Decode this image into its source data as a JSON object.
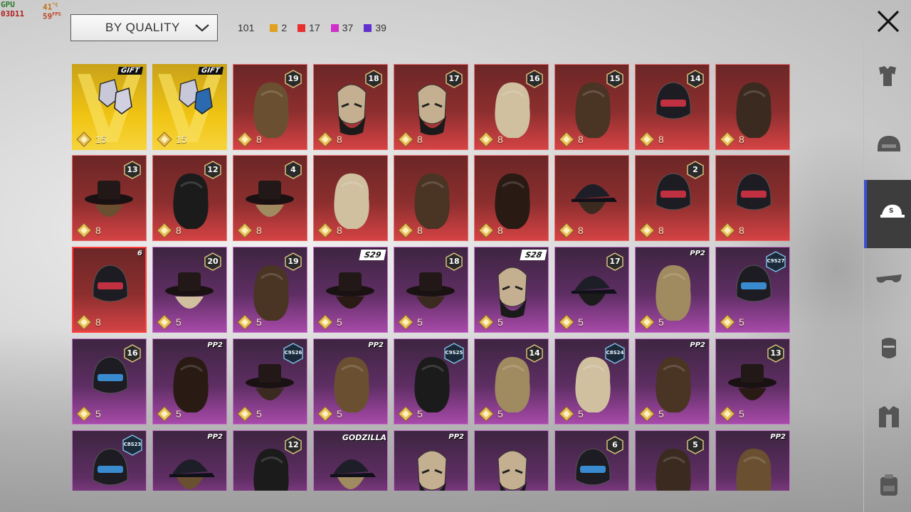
{
  "hud": {
    "gpu_label": "GPU",
    "gpu_value": "03D11",
    "temp": "41",
    "temp_unit": "°C",
    "fps": "59",
    "fps_unit": "FPS"
  },
  "sort": {
    "label": "BY QUALITY"
  },
  "counts": {
    "total": "101",
    "items": [
      {
        "value": "2",
        "color": "#e0a020"
      },
      {
        "value": "17",
        "color": "#e83030"
      },
      {
        "value": "37",
        "color": "#d030c8"
      },
      {
        "value": "39",
        "color": "#6030d0"
      }
    ]
  },
  "tiles": [
    {
      "quality": "legend",
      "price": "15",
      "tag": "GIFT",
      "icon": "legendary-bundle-icon"
    },
    {
      "quality": "legend",
      "price": "15",
      "tag": "GIFT",
      "icon": "legendary-bundle-icon"
    },
    {
      "quality": "red",
      "price": "8",
      "badge": "19",
      "icon": "hair-icon"
    },
    {
      "quality": "red",
      "price": "8",
      "badge": "18",
      "icon": "mask-icon"
    },
    {
      "quality": "red",
      "price": "8",
      "badge": "17",
      "icon": "mask-icon"
    },
    {
      "quality": "red",
      "price": "8",
      "badge": "16",
      "icon": "hair-icon"
    },
    {
      "quality": "red",
      "price": "8",
      "badge": "15",
      "icon": "hair-icon"
    },
    {
      "quality": "red",
      "price": "8",
      "badge": "14",
      "icon": "helmet-icon"
    },
    {
      "quality": "red",
      "price": "8",
      "icon": "hair-icon"
    },
    {
      "quality": "red",
      "price": "8",
      "badge": "13",
      "icon": "hat-icon"
    },
    {
      "quality": "red",
      "price": "8",
      "badge": "12",
      "icon": "hair-icon"
    },
    {
      "quality": "red",
      "price": "8",
      "badge": "4",
      "icon": "hat-icon"
    },
    {
      "quality": "red",
      "price": "8",
      "icon": "hair-icon"
    },
    {
      "quality": "red",
      "price": "8",
      "icon": "hair-icon"
    },
    {
      "quality": "red",
      "price": "8",
      "icon": "hair-icon"
    },
    {
      "quality": "red",
      "price": "8",
      "icon": "cap-icon"
    },
    {
      "quality": "red",
      "price": "8",
      "badge": "2",
      "icon": "helmet-icon"
    },
    {
      "quality": "red",
      "price": "8",
      "icon": "helmet-icon"
    },
    {
      "quality": "red",
      "price": "8",
      "tag": "6",
      "icon": "helmet-icon",
      "highlight": true
    },
    {
      "quality": "purple",
      "price": "5",
      "badge": "20",
      "icon": "hat-icon"
    },
    {
      "quality": "purple",
      "price": "5",
      "badge": "19",
      "icon": "hair-icon"
    },
    {
      "quality": "purple",
      "price": "5",
      "ribbon": "S29",
      "icon": "hat-icon"
    },
    {
      "quality": "purple",
      "price": "5",
      "badge": "18",
      "icon": "hat-icon"
    },
    {
      "quality": "purple",
      "price": "5",
      "ribbon": "S28",
      "icon": "mask-icon"
    },
    {
      "quality": "purple",
      "price": "5",
      "badge": "17",
      "icon": "cap-icon"
    },
    {
      "quality": "purple",
      "price": "5",
      "tag": "PP2",
      "icon": "hair-icon"
    },
    {
      "quality": "purple",
      "price": "5",
      "season": "C9S27",
      "icon": "helmet-icon"
    },
    {
      "quality": "purple",
      "price": "5",
      "badge": "16",
      "icon": "helmet-icon"
    },
    {
      "quality": "purple",
      "price": "5",
      "tag": "PP2",
      "icon": "hair-icon"
    },
    {
      "quality": "purple",
      "price": "5",
      "season": "C9S26",
      "icon": "hat-icon"
    },
    {
      "quality": "purple",
      "price": "5",
      "tag": "PP2",
      "icon": "hair-icon"
    },
    {
      "quality": "purple",
      "price": "5",
      "season": "C9S25",
      "icon": "hair-icon"
    },
    {
      "quality": "purple",
      "price": "5",
      "badge": "14",
      "icon": "hair-icon"
    },
    {
      "quality": "purple",
      "price": "5",
      "season": "C8S24",
      "icon": "hair-icon"
    },
    {
      "quality": "purple",
      "price": "5",
      "tag": "PP2",
      "icon": "hair-icon"
    },
    {
      "quality": "purple",
      "price": "5",
      "badge": "13",
      "icon": "hat-icon"
    },
    {
      "quality": "purple",
      "price": "5",
      "season": "C8S23",
      "icon": "helmet-icon"
    },
    {
      "quality": "purple",
      "price": "5",
      "tag": "PP2",
      "icon": "cap-icon"
    },
    {
      "quality": "purple",
      "price": "5",
      "badge": "12",
      "icon": "hair-icon"
    },
    {
      "quality": "purple",
      "price": "5",
      "tag": "GODZILLA",
      "icon": "cap-icon"
    },
    {
      "quality": "purple",
      "price": "5",
      "tag": "PP2",
      "icon": "mask-icon"
    },
    {
      "quality": "purple",
      "price": "5",
      "icon": "mask-icon"
    },
    {
      "quality": "purple",
      "price": "5",
      "badge": "6",
      "icon": "helmet-icon"
    },
    {
      "quality": "purple",
      "price": "5",
      "badge": "5",
      "icon": "hair-icon"
    },
    {
      "quality": "purple",
      "price": "5",
      "tag": "PP2",
      "icon": "hair-icon"
    }
  ],
  "sidebar": [
    {
      "name": "outfit-icon",
      "active": false
    },
    {
      "name": "helmet-icon",
      "active": false
    },
    {
      "name": "cap-icon",
      "active": true
    },
    {
      "name": "glasses-icon",
      "active": false
    },
    {
      "name": "face-mask-icon",
      "active": false
    },
    {
      "name": "jacket-icon",
      "active": false
    },
    {
      "name": "backpack-icon",
      "active": false
    }
  ]
}
